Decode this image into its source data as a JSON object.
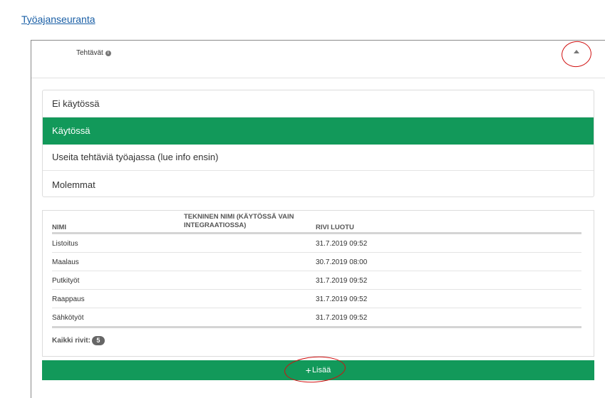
{
  "top_link": "Työajanseuranta",
  "panel": {
    "title": "Tehtävät",
    "info_icon": "info-icon",
    "collapse_icon": "caret-up-icon"
  },
  "options": [
    {
      "label": "Ei käytössä",
      "active": false
    },
    {
      "label": "Käytössä",
      "active": true
    },
    {
      "label": "Useita tehtäviä työajassa (lue info ensin)",
      "active": false
    },
    {
      "label": "Molemmat",
      "active": false
    }
  ],
  "table": {
    "headers": {
      "name": "Nimi",
      "technical_name": "Tekninen nimi (käytössä vain integraatiossa)",
      "created": "Rivi luotu"
    },
    "rows": [
      {
        "name": "Listoitus",
        "technical_name": "",
        "created": "31.7.2019 09:52"
      },
      {
        "name": "Maalaus",
        "technical_name": "",
        "created": "30.7.2019 08:00"
      },
      {
        "name": "Putkityöt",
        "technical_name": "",
        "created": "31.7.2019 09:52"
      },
      {
        "name": "Raappaus",
        "technical_name": "",
        "created": "31.7.2019 09:52"
      },
      {
        "name": "Sähkötyöt",
        "technical_name": "",
        "created": "31.7.2019 09:52"
      }
    ],
    "total_label": "Kaikki rivit:",
    "total_count": "5"
  },
  "add_button": {
    "label": "Lisää",
    "icon": "plus-icon"
  },
  "colors": {
    "accent_green": "#12995a",
    "link_blue": "#1a5fa6",
    "annotation_red": "#d01010"
  }
}
